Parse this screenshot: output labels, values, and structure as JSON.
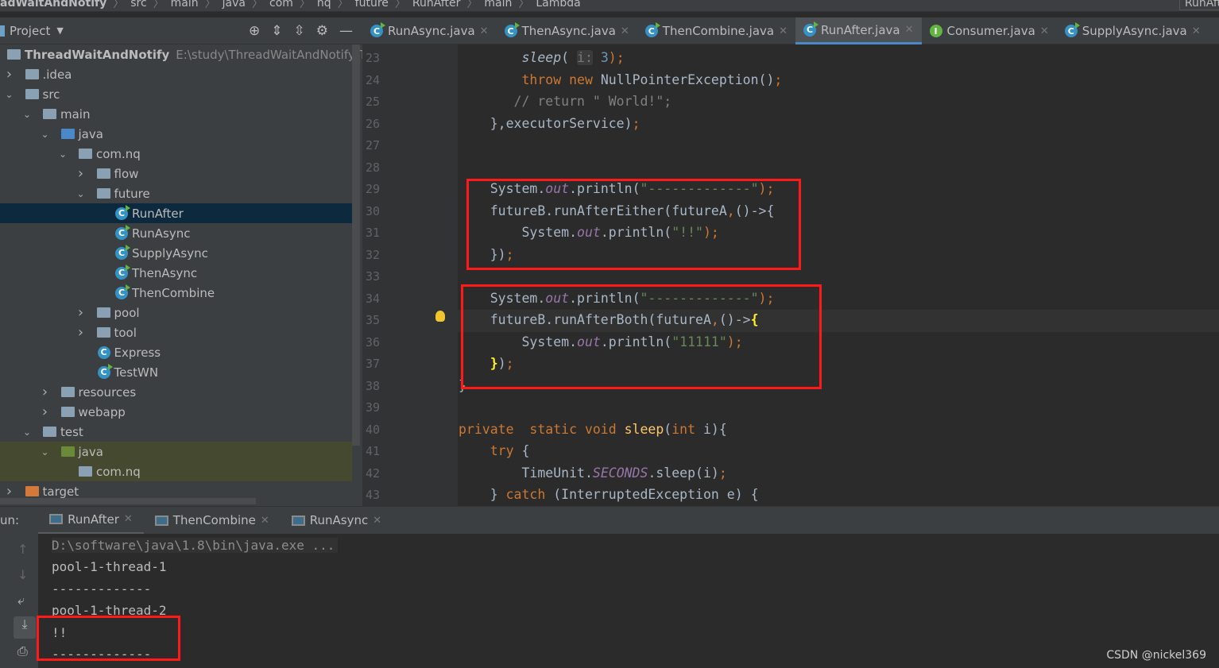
{
  "breadcrumb": [
    "adWaitAndNotify",
    "src",
    "main",
    "java",
    "com",
    "nq",
    "future",
    "RunAfter",
    "main",
    "Lambda"
  ],
  "run_config": "RunAft",
  "project_panel": {
    "title": "Project"
  },
  "tabs": [
    {
      "label": "RunAsync.java",
      "active": false
    },
    {
      "label": "ThenAsync.java",
      "active": false
    },
    {
      "label": "ThenCombine.java",
      "active": false
    },
    {
      "label": "RunAfter.java",
      "active": true
    },
    {
      "label": "Consumer.java",
      "active": false,
      "icon": "interface"
    },
    {
      "label": "SupplyAsync.java",
      "active": false
    }
  ],
  "tree": [
    {
      "label": "ThreadWaitAndNotify",
      "path": "E:\\study\\ThreadWaitAndNotify\\Th",
      "depth": 0,
      "arrow": "",
      "icon": "module"
    },
    {
      "label": ".idea",
      "depth": 1,
      "arrow": "right",
      "icon": "folder"
    },
    {
      "label": "src",
      "depth": 1,
      "arrow": "down",
      "icon": "folder"
    },
    {
      "label": "main",
      "depth": 2,
      "arrow": "down",
      "icon": "folder"
    },
    {
      "label": "java",
      "depth": 3,
      "arrow": "down",
      "icon": "folder-src"
    },
    {
      "label": "com.nq",
      "depth": 4,
      "arrow": "down",
      "icon": "package"
    },
    {
      "label": "flow",
      "depth": 5,
      "arrow": "right",
      "icon": "package"
    },
    {
      "label": "future",
      "depth": 5,
      "arrow": "down",
      "icon": "package"
    },
    {
      "label": "RunAfter",
      "depth": 6,
      "arrow": "",
      "icon": "class-run",
      "selected": true
    },
    {
      "label": "RunAsync",
      "depth": 6,
      "arrow": "",
      "icon": "class-run"
    },
    {
      "label": "SupplyAsync",
      "depth": 6,
      "arrow": "",
      "icon": "class-run"
    },
    {
      "label": "ThenAsync",
      "depth": 6,
      "arrow": "",
      "icon": "class-run"
    },
    {
      "label": "ThenCombine",
      "depth": 6,
      "arrow": "",
      "icon": "class-run"
    },
    {
      "label": "pool",
      "depth": 5,
      "arrow": "right",
      "icon": "package"
    },
    {
      "label": "tool",
      "depth": 5,
      "arrow": "right",
      "icon": "package"
    },
    {
      "label": "Express",
      "depth": 5,
      "arrow": "",
      "icon": "class"
    },
    {
      "label": "TestWN",
      "depth": 5,
      "arrow": "",
      "icon": "class-run"
    },
    {
      "label": "resources",
      "depth": 3,
      "arrow": "right",
      "icon": "folder-res"
    },
    {
      "label": "webapp",
      "depth": 3,
      "arrow": "right",
      "icon": "folder"
    },
    {
      "label": "test",
      "depth": 2,
      "arrow": "down",
      "icon": "folder"
    },
    {
      "label": "java",
      "depth": 3,
      "arrow": "down",
      "icon": "folder-test",
      "test": true
    },
    {
      "label": "com.nq",
      "depth": 4,
      "arrow": "",
      "icon": "package",
      "test": true
    },
    {
      "label": "target",
      "depth": 1,
      "arrow": "right",
      "icon": "folder-excluded"
    }
  ],
  "code": [
    {
      "n": "23",
      "t": [
        [
          "        ",
          ""
        ],
        [
          "sleep",
          "it"
        ],
        [
          "( ",
          ""
        ],
        [
          "i:",
          "hint"
        ],
        [
          " ",
          ""
        ],
        [
          "3",
          "num"
        ],
        [
          ");",
          "kw"
        ]
      ]
    },
    {
      "n": "24",
      "t": [
        [
          "        ",
          ""
        ],
        [
          "throw new ",
          "kw"
        ],
        [
          "NullPointerException()",
          ""
        ],
        [
          ";",
          "kw"
        ]
      ]
    },
    {
      "n": "25",
      "t": [
        [
          "       ",
          ""
        ],
        [
          "// return \" World!\";",
          "cm"
        ]
      ]
    },
    {
      "n": "26",
      "t": [
        [
          "    },",
          ""
        ],
        [
          "executorService)",
          ""
        ],
        [
          ";",
          "kw"
        ]
      ]
    },
    {
      "n": "27",
      "t": []
    },
    {
      "n": "28",
      "t": []
    },
    {
      "n": "29",
      "t": [
        [
          "    System.",
          ""
        ],
        [
          "out",
          "fld"
        ],
        [
          ".println(",
          ""
        ],
        [
          "\"-------------\"",
          "str"
        ],
        [
          ");",
          "kw"
        ]
      ]
    },
    {
      "n": "30",
      "t": [
        [
          "    futureB.runAfterEither(futureA",
          ""
        ],
        [
          ",",
          "kw"
        ],
        [
          "()->{",
          ""
        ]
      ]
    },
    {
      "n": "31",
      "t": [
        [
          "        System.",
          ""
        ],
        [
          "out",
          "fld"
        ],
        [
          ".println(",
          ""
        ],
        [
          "\"!!\"",
          "str"
        ],
        [
          ");",
          "kw"
        ]
      ]
    },
    {
      "n": "32",
      "t": [
        [
          "    })",
          ""
        ],
        [
          ";",
          "kw"
        ]
      ]
    },
    {
      "n": "33",
      "t": []
    },
    {
      "n": "34",
      "t": [
        [
          "    System.",
          ""
        ],
        [
          "out",
          "fld"
        ],
        [
          ".println(",
          ""
        ],
        [
          "\"-------------\"",
          "str"
        ],
        [
          ");",
          "kw"
        ]
      ]
    },
    {
      "n": "35",
      "t": [
        [
          "    futureB.runAfterBoth(futureA",
          ""
        ],
        [
          ",",
          "kw"
        ],
        [
          "()->",
          ""
        ],
        [
          "{",
          "br"
        ]
      ]
    },
    {
      "n": "36",
      "t": [
        [
          "        System.",
          ""
        ],
        [
          "out",
          "fld"
        ],
        [
          ".println(",
          ""
        ],
        [
          "\"11111\"",
          "str"
        ],
        [
          ");",
          "kw"
        ]
      ]
    },
    {
      "n": "37",
      "t": [
        [
          "    ",
          ""
        ],
        [
          "}",
          "br"
        ],
        [
          ")",
          ""
        ],
        [
          ";",
          "kw"
        ]
      ]
    },
    {
      "n": "38",
      "t": [
        [
          "}",
          ""
        ]
      ]
    },
    {
      "n": "39",
      "t": []
    },
    {
      "n": "40",
      "t": [
        [
          "private  static void ",
          "kw"
        ],
        [
          "sleep",
          "fn"
        ],
        [
          "(",
          ""
        ],
        [
          "int ",
          "kw"
        ],
        [
          "i){",
          ""
        ]
      ]
    },
    {
      "n": "41",
      "t": [
        [
          "    ",
          ""
        ],
        [
          "try ",
          "kw"
        ],
        [
          "{",
          ""
        ]
      ]
    },
    {
      "n": "42",
      "t": [
        [
          "        TimeUnit.",
          ""
        ],
        [
          "SECONDS",
          "fld"
        ],
        [
          ".sleep(i)",
          ""
        ],
        [
          ";",
          "kw"
        ]
      ]
    },
    {
      "n": "43",
      "t": [
        [
          "    } ",
          ""
        ],
        [
          "catch ",
          "kw"
        ],
        [
          "(InterruptedException e) {",
          ""
        ]
      ]
    }
  ],
  "run": {
    "label": "un:",
    "tabs": [
      "RunAfter",
      "ThenCombine",
      "RunAsync"
    ]
  },
  "console": {
    "command": "D:\\software\\java\\1.8\\bin\\java.exe ...",
    "lines": [
      "pool-1-thread-1",
      "-------------",
      "pool-1-thread-2",
      "!!",
      "-------------"
    ]
  },
  "watermark": "CSDN @nickel369",
  "colors": {
    "highlight_box": "#ff1a1a",
    "selection": "#0d293e",
    "keyword": "#cc7832",
    "string": "#6a8759"
  }
}
